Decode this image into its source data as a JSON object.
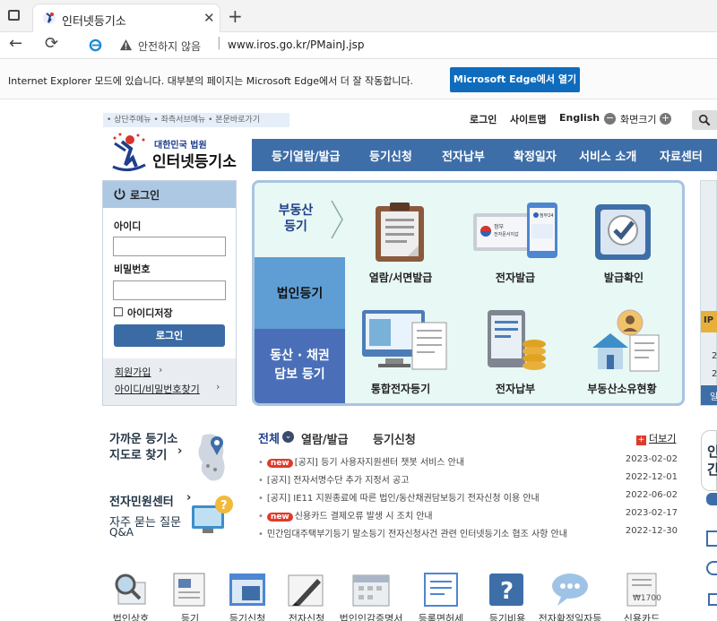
{
  "browser": {
    "tab_title": "인터넷등기소",
    "security_text": "안전하지 않음",
    "url": "www.iros.go.kr/PMainJ.jsp"
  },
  "ie_banner": {
    "message": "Internet Explorer 모드에 있습니다. 대부분의 페이지는 Microsoft Edge에서 더 잘 작동합니다.",
    "button_label": "Microsoft Edge에서 열기"
  },
  "skip_nav": "• 상단주메뉴 • 좌측서브메뉴 • 본문바로가기",
  "top_links": {
    "login": "로그인",
    "sitemap": "사이트맵",
    "english": "English",
    "screen_size": "화면크기"
  },
  "logo": {
    "line1": "대한민국 법원",
    "line2": "인터넷등기소"
  },
  "gnb": [
    "등기열람/발급",
    "등기신청",
    "전자납부",
    "확정일자",
    "서비스 소개",
    "자료센터"
  ],
  "login": {
    "title": "로그인",
    "id_label": "아이디",
    "pw_label": "비밀번호",
    "remember_label": "아이디저장",
    "button": "로그인",
    "join": "회원가입",
    "find": "아이디/비밀번호찾기"
  },
  "services": {
    "side": [
      "부동산\n등기",
      "법인등기",
      "동산 · 채권\n담보 등기"
    ],
    "items": [
      "열람/서면발급",
      "전자발급",
      "발급확인",
      "통합전자등기",
      "전자납부",
      "부동산소유현황"
    ],
    "gov_text1": "정부\n전자문서지갑",
    "gov_text2": "정부24\n전자문서"
  },
  "left_links": {
    "near_office_line1": "가까운 등기소",
    "near_office_line2": "지도로 찾기",
    "civil_center": "전자민원센터",
    "faq_line1": "자주 묻는 질문",
    "faq_line2": "Q&A"
  },
  "news": {
    "tabs": [
      "전체",
      "열람/발급",
      "등기신청"
    ],
    "more": "더보기",
    "new_badge": "new",
    "items": [
      {
        "new": true,
        "title": "[공지] 등기 사용자지원센터 챗봇 서비스 안내",
        "date": "2023-02-02"
      },
      {
        "new": false,
        "title": "[공지] 전자서명수단 추가 지정서 공고",
        "date": "2022-12-01"
      },
      {
        "new": false,
        "title": "[공지] IE11 지원종료에 따른 법인/동산채권담보등기 전자신청 이용 안내",
        "date": "2022-06-02"
      },
      {
        "new": true,
        "title": "신용카드 결제오류 발생 시 조치 안내",
        "date": "2023-02-17"
      },
      {
        "new": false,
        "title": "민간임대주택부기등기 말소등기 전자신청사건 관련 인터넷등기소 협조 사항 안내",
        "date": "2022-12-30"
      }
    ]
  },
  "bottom": [
    "법인상호",
    "등기",
    "등기신청",
    "전자신청",
    "법인인감증명서",
    "등록면허세",
    "등기비용",
    "전자확정일자등",
    "신용카드"
  ],
  "right_partial": {
    "ip": "IP",
    "num1": "2",
    "num2": "2",
    "tail": "일",
    "card1": "인",
    "card2": "간"
  }
}
